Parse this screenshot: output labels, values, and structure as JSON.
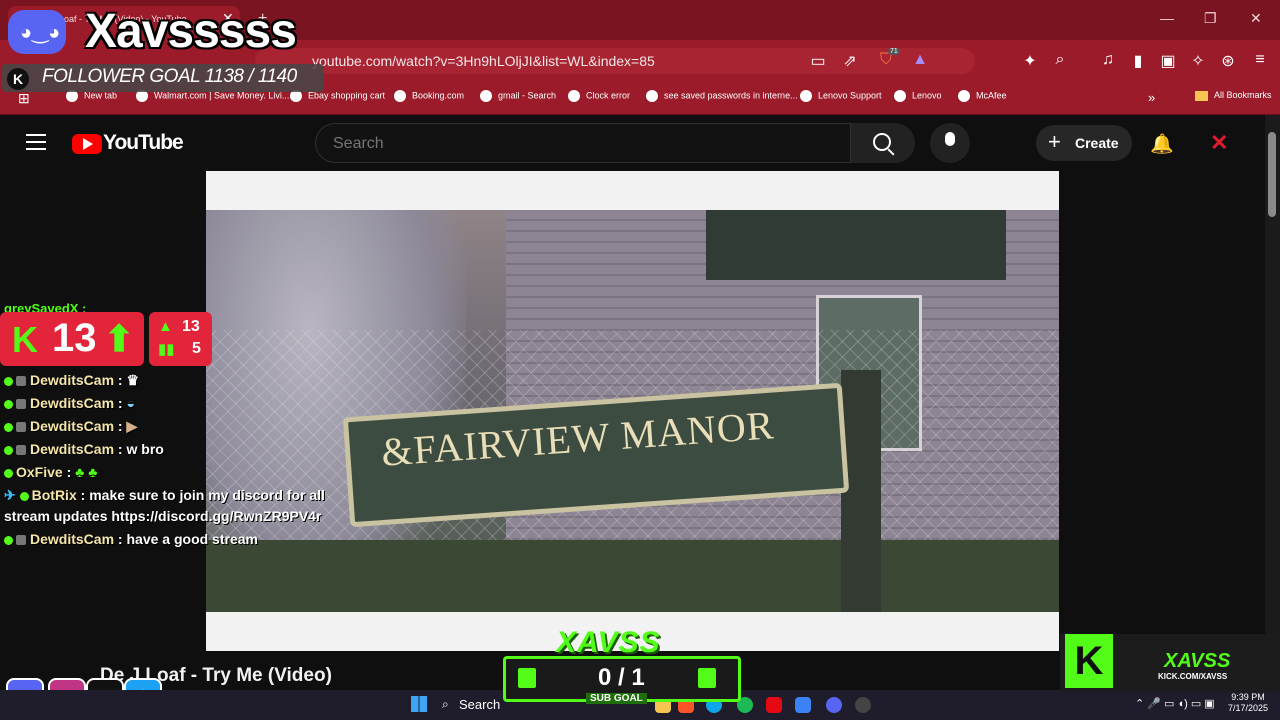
{
  "browser": {
    "tab_title": "De J Loaf - Try Me (Video) - YouTube",
    "new_tab": "+",
    "url": "youtube.com/watch?v=3Hn9hLOljJI&list=WL&index=85",
    "bookmarks": [
      "New tab",
      "Walmart.com | Save Money. Livi...",
      "Ebay shopping cart",
      "Booking.com",
      "gmail - Search",
      "Clock error",
      "see saved passwords in interne...",
      "Lenovo Support",
      "Lenovo",
      "McAfee"
    ],
    "all_bookmarks": "All Bookmarks",
    "brave_badge": "71"
  },
  "youtube": {
    "logo_text": "YouTube",
    "search_placeholder": "Search",
    "create_label": "Create",
    "video_title": "De J Loaf - Try Me (Video)",
    "sign_text": "&FAIRVIEW MANOR"
  },
  "stream_overlay": {
    "streamer_name": "Xavsssss",
    "follower_goal": "FOLLOWER GOAL 1138 / 1140",
    "kick_count": "13",
    "stat_up": "13",
    "stat_bars": "5",
    "partial_user": "greySavedX :",
    "chat": [
      {
        "user": "DewditsCam",
        "msg": ""
      },
      {
        "user": "DewditsCam",
        "msg": ""
      },
      {
        "user": "DewditsCam",
        "msg": ""
      },
      {
        "user": "DewditsCam",
        "msg": "w bro"
      },
      {
        "user": "OxFive",
        "msg": ""
      },
      {
        "user": "BotRix",
        "msg": "make sure to join my discord for all"
      },
      {
        "user": "",
        "msg": "stream updates https://discord.gg/RwnZR9PV4r"
      },
      {
        "user": "DewditsCam",
        "msg": "have a good stream"
      }
    ],
    "subgoal_logo": "XAVSS",
    "subgoal_count": "0 / 1",
    "subgoal_label": "SUB GOAL",
    "card_name": "XAVSS",
    "card_url": "KICK.COM/XAVSS",
    "card_k": "K"
  },
  "taskbar": {
    "search_label": "Search",
    "time": "9:39 PM",
    "date": "7/17/2025"
  },
  "colors": {
    "browser_accent": "#9b1b2a",
    "kick_green": "#53fc18",
    "kick_red": "#e3253c",
    "youtube_red": "#ff0000"
  }
}
